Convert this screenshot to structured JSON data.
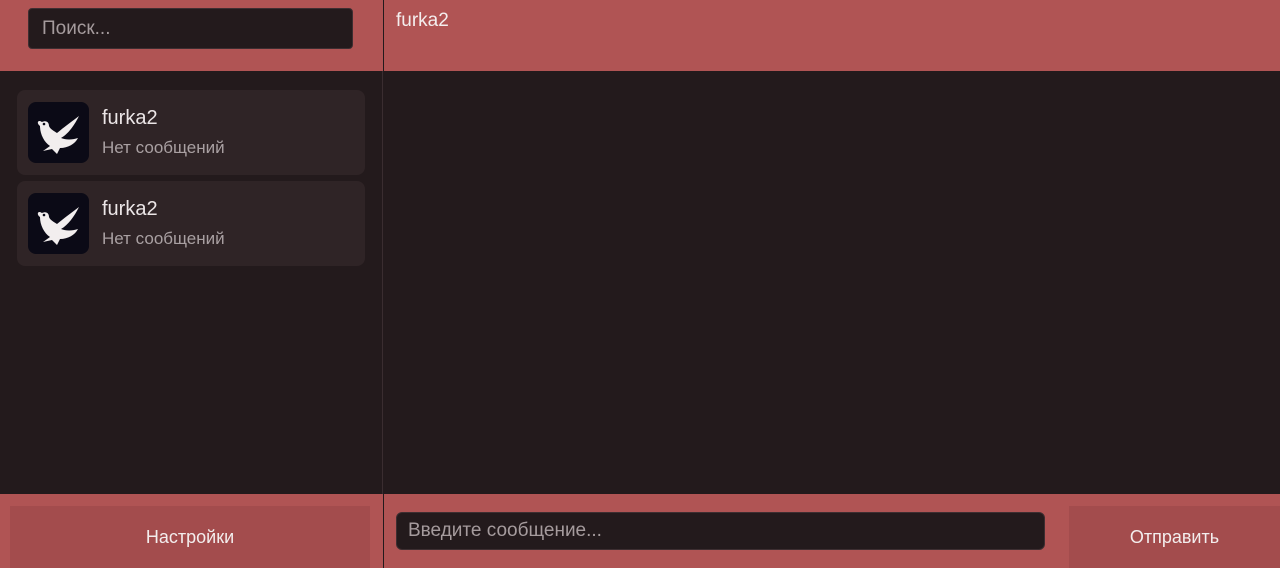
{
  "sidebar": {
    "search": {
      "placeholder": "Поиск..."
    },
    "chats": [
      {
        "name": "furka2",
        "preview": "Нет сообщений",
        "avatar_icon": "dove-icon"
      },
      {
        "name": "furka2",
        "preview": "Нет сообщений",
        "avatar_icon": "dove-icon"
      }
    ],
    "settings_label": "Настройки"
  },
  "chat": {
    "title": "furka2",
    "input": {
      "placeholder": "Введите сообщение..."
    },
    "send_label": "Отправить"
  },
  "colors": {
    "accent": "#b05454",
    "background": "#231a1c",
    "card": "#2f2426",
    "button": "#a34c4d"
  }
}
